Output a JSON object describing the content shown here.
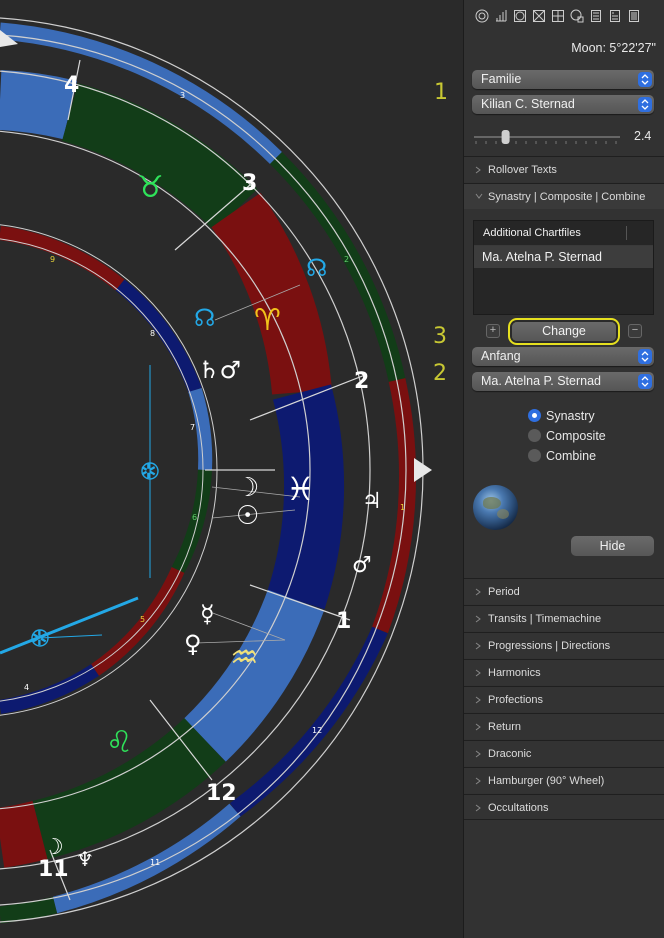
{
  "chart": {
    "annotations": [
      "1",
      "3",
      "2"
    ],
    "house_numbers": [
      "4",
      "3",
      "2",
      "1",
      "12",
      "11"
    ],
    "ring_labels": [
      "3",
      "2",
      "1",
      "12",
      "11",
      "9",
      "8",
      "7",
      "6",
      "5",
      "4"
    ],
    "glyphs": {
      "taurus": "♉",
      "aries": "♈",
      "pisces": "♓",
      "aquarius": "♒",
      "leo": "♌",
      "node_1": "☊",
      "node_2": "☊",
      "saturn_mars": "♄♂",
      "moon_1": "☽",
      "sun": "☉",
      "jupiter": "♃",
      "mars": "♂",
      "mercury": "☿",
      "venus": "♀",
      "moon_2": "☽",
      "neptune": "♆",
      "star_1": "✲",
      "star_2": "✲"
    },
    "colors": {
      "blue_band": "#3b6cb8",
      "green_band": "#123d18",
      "red_band": "#7a1010",
      "navy_band": "#0d1a70",
      "aspect_blue": "#23a8e6"
    }
  },
  "panel": {
    "toolbar_icons": [
      "wheel-icon",
      "bar-chart-icon",
      "aspect-grid-icon",
      "cross-grid-icon",
      "table-icon",
      "clock-icon",
      "text-list-icon",
      "document-icon",
      "list-icon"
    ],
    "moon_readout": "Moon: 5°22'27\"",
    "group_select": "Familie",
    "person_select": "Kilian C. Sternad",
    "slider_value": "2.4",
    "slider_fraction": 0.2,
    "sections_top": [
      "Rollover Texts",
      "Synastry | Composite | Combine"
    ],
    "chartfiles_header": "Additional Chartfiles",
    "chartfiles_rows": [
      "Ma. Atelna P. Sternad"
    ],
    "change_label": "Change",
    "add_symbol": "+",
    "remove_symbol": "−",
    "start_select": "Anfang",
    "partner_select": "Ma. Atelna P. Sternad",
    "radios": [
      {
        "label": "Synastry",
        "selected": true
      },
      {
        "label": "Composite",
        "selected": false
      },
      {
        "label": "Combine",
        "selected": false
      }
    ],
    "hide_label": "Hide",
    "sections_bottom": [
      "Period",
      "Transits | Timemachine",
      "Progressions | Directions",
      "Harmonics",
      "Profections",
      "Return",
      "Draconic",
      "Hamburger (90° Wheel)",
      "Occultations"
    ]
  }
}
